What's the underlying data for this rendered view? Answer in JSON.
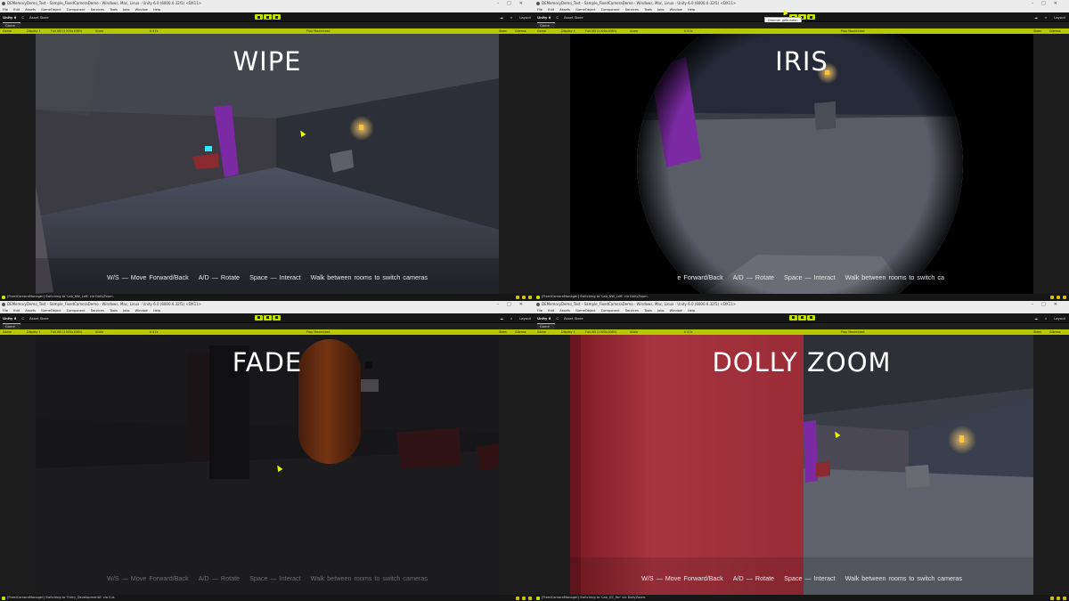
{
  "editor": {
    "window_title_top": "DEMemoryDemo_Test - Sample_FixedCameraDemo - Windows, Mac, Linux - Unity 6.0 (6000.0.32f1) <DX11>",
    "window_title_bottom": "DEMemoryDemo_Test - Sample_FixedCameraDemo - Windows, Mac, Linux - Unity 6.0 (6000.0.32f1) <DX11>",
    "menu": [
      "File",
      "Edit",
      "Assets",
      "GameObject",
      "Component",
      "Services",
      "Tools",
      "Jobs",
      "Window",
      "Help"
    ],
    "toolbar": {
      "unity_label": "Unity 6",
      "account_label": "C",
      "asset_store_label": "Asset Store",
      "layout_label": "Layout"
    },
    "game_tab_label": "Game",
    "game_bar": {
      "view_label": "Game",
      "display_label": "Display 1",
      "resolution_label": "Full HD (1920x1080)",
      "scale_label": "Scale",
      "scale_value": "0.47x",
      "play_mode_label": "Play Maximized",
      "stats_label": "Stats",
      "gizmos_label": "Gizmos"
    },
    "tooltip_label": "Dimmer gebunden"
  },
  "hints": {
    "move": "W/S — Move Forward/Back",
    "rotate": "A/D — Rotate",
    "interact": "Space — Interact",
    "walk": "Walk between rooms to switch cameras"
  },
  "panels": [
    {
      "id": "wipe",
      "label": "WIPE",
      "status": "[FixedCameraManager] Switching to 'Lab_NW_Left' via DollyZoom."
    },
    {
      "id": "iris",
      "label": "IRIS",
      "status": "[FixedCameraManager] Switching to 'Lab_NW_Left' via DollyZoom."
    },
    {
      "id": "fade",
      "label": "FADE",
      "status": "[FixedCameraManager] Switching to 'Entry_DevelopmentA' via Cut."
    },
    {
      "id": "dolly",
      "label": "DOLLY ZOOM",
      "status": "[FixedCameraManager] Switching to 'Lab_D2_Far' via DollyZoom."
    }
  ],
  "colors": {
    "accent": "#c4e000",
    "editor_dark": "#161616",
    "room_wall": "#3a3c46",
    "pillar_purple": "#7a2aa0",
    "box_red": "#8e2a30",
    "capsule_orange": "#b4501e",
    "lamp": "#ffb830"
  }
}
